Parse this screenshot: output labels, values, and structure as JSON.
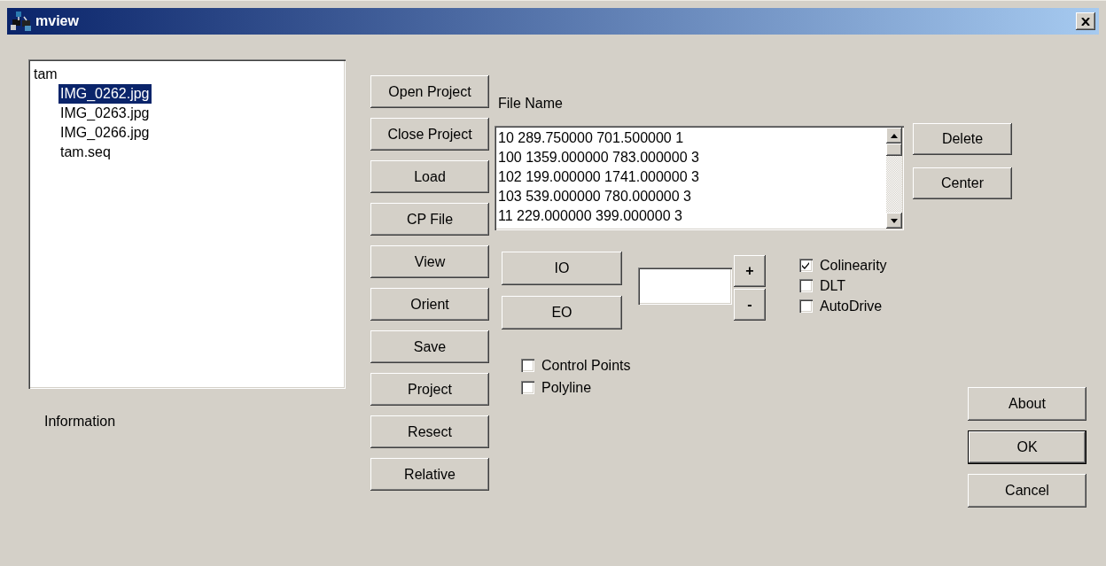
{
  "window": {
    "title": "mview"
  },
  "tree": {
    "label": "tam",
    "selected": false,
    "children": [
      {
        "label": "IMG_0262.jpg",
        "selected": true
      },
      {
        "label": "IMG_0263.jpg",
        "selected": false
      },
      {
        "label": "IMG_0266.jpg",
        "selected": false
      },
      {
        "label": "tam.seq",
        "selected": false
      }
    ]
  },
  "information_label": "Information",
  "side_buttons": [
    "Open Project",
    "Close Project",
    "Load",
    "CP File",
    "View",
    "Orient",
    "Save",
    "Project",
    "Resect",
    "Relative"
  ],
  "file_list": {
    "label": "File Name",
    "items": [
      "10 289.750000 701.500000 1",
      "100 1359.000000 783.000000 3",
      "102 199.000000 1741.000000 3",
      "103 539.000000 780.000000 3",
      "11 229.000000 399.000000 3"
    ]
  },
  "list_buttons": [
    "Delete",
    "Center"
  ],
  "orientation_buttons": [
    "IO",
    "EO"
  ],
  "spin_buttons": [
    "+",
    "-"
  ],
  "methods": [
    {
      "label": "Colinearity",
      "checked": true
    },
    {
      "label": "DLT",
      "checked": false
    },
    {
      "label": "AutoDrive",
      "checked": false
    }
  ],
  "display_options": [
    {
      "label": "Control Points",
      "checked": false
    },
    {
      "label": "Polyline",
      "checked": false
    }
  ],
  "dialog_buttons": [
    {
      "label": "About",
      "default": false
    },
    {
      "label": "OK",
      "default": true
    },
    {
      "label": "Cancel",
      "default": false
    }
  ]
}
